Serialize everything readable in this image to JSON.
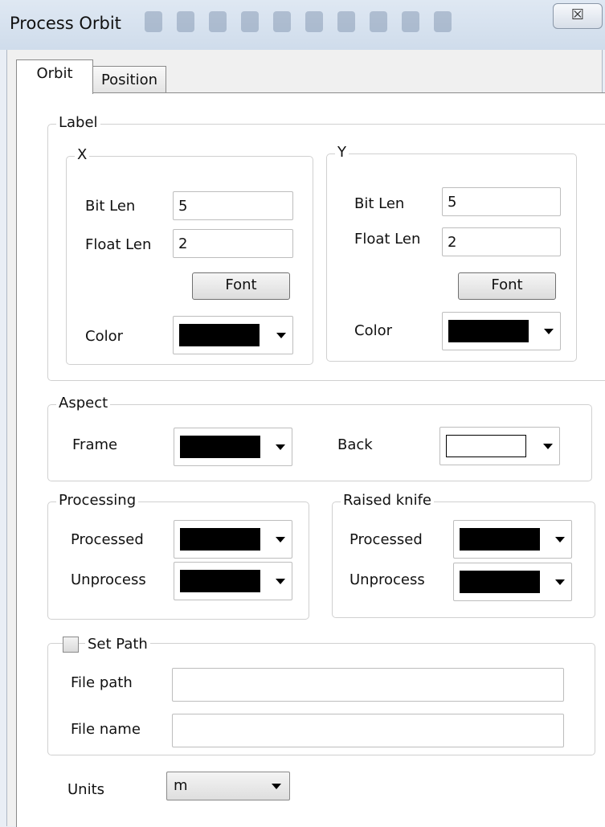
{
  "window": {
    "title": "Process Orbit",
    "close_glyph": "☒"
  },
  "tabs": [
    {
      "label": "Orbit",
      "active": true
    },
    {
      "label": "Position",
      "active": false
    }
  ],
  "label_group": {
    "title": "Label",
    "x": {
      "title": "X",
      "bit_len_label": "Bit Len",
      "bit_len_value": "5",
      "float_len_label": "Float Len",
      "float_len_value": "2",
      "font_button": "Font",
      "color_label": "Color",
      "color_value": "#000000"
    },
    "y": {
      "title": "Y",
      "bit_len_label": "Bit Len",
      "bit_len_value": "5",
      "float_len_label": "Float Len",
      "float_len_value": "2",
      "font_button": "Font",
      "color_label": "Color",
      "color_value": "#000000"
    }
  },
  "aspect": {
    "title": "Aspect",
    "frame_label": "Frame",
    "frame_color": "#000000",
    "back_label": "Back",
    "back_color": "#ffffff"
  },
  "processing": {
    "title": "Processing",
    "processed_label": "Processed",
    "processed_color": "#000000",
    "unprocess_label": "Unprocess",
    "unprocess_color": "#000000"
  },
  "raised_knife": {
    "title": "Raised knife",
    "processed_label": "Processed",
    "processed_color": "#000000",
    "unprocess_label": "Unprocess",
    "unprocess_color": "#000000"
  },
  "set_path": {
    "checkbox_label": "Set Path",
    "checked": false,
    "file_path_label": "File path",
    "file_path_value": "",
    "file_name_label": "File name",
    "file_name_value": ""
  },
  "units": {
    "label": "Units",
    "selected": "m"
  }
}
